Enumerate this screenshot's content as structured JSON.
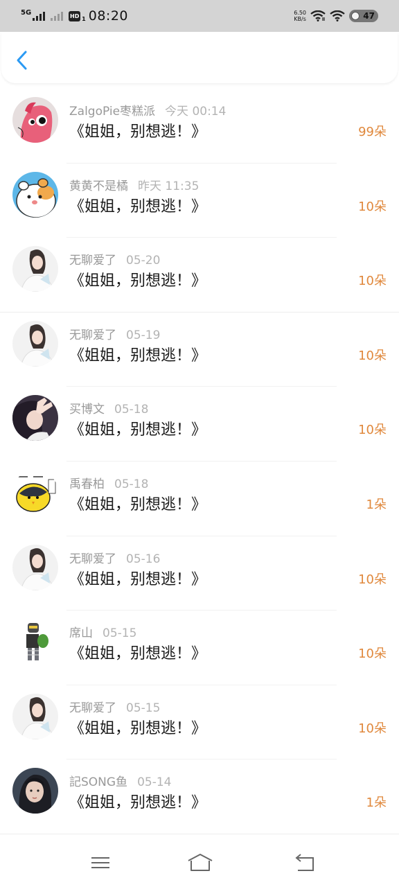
{
  "status_bar": {
    "network": "5G",
    "hd": "HD",
    "hd_sub": "1",
    "time": "08:20",
    "speed_value": "6.50",
    "speed_unit": "KB/s",
    "battery": "47"
  },
  "header": {
    "back_icon": "chevron-left-icon"
  },
  "gift_rows": [
    {
      "user": "ZalgoPie枣糕派",
      "time": "今天 00:14",
      "gift": "《姐姐，别想逃！》",
      "count": "99朵",
      "avatar": "pink-pony"
    },
    {
      "user": "黄黄不是橘",
      "time": "昨天 11:35",
      "gift": "《姐姐，别想逃！》",
      "count": "10朵",
      "avatar": "hamster"
    },
    {
      "user": "无聊爱了",
      "time": "05-20",
      "gift": "《姐姐，别想逃！》",
      "count": "10朵",
      "avatar": "girl-white"
    },
    {
      "user": "无聊爱了",
      "time": "05-19",
      "gift": "《姐姐，别想逃！》",
      "count": "10朵",
      "avatar": "girl-white"
    },
    {
      "user": "买博文",
      "time": "05-18",
      "gift": "《姐姐，别想逃！》",
      "count": "10朵",
      "avatar": "girl-hand"
    },
    {
      "user": "禹春柏",
      "time": "05-18",
      "gift": "《姐姐，别想逃！》",
      "count": "1朵",
      "avatar": "yellow-chick"
    },
    {
      "user": "无聊爱了",
      "time": "05-16",
      "gift": "《姐姐，别想逃！》",
      "count": "10朵",
      "avatar": "girl-white"
    },
    {
      "user": "席山",
      "time": "05-15",
      "gift": "《姐姐，别想逃！》",
      "count": "10朵",
      "avatar": "robot-figure"
    },
    {
      "user": "无聊爱了",
      "time": "05-15",
      "gift": "《姐姐，别想逃！》",
      "count": "10朵",
      "avatar": "girl-white"
    },
    {
      "user": "記SONG鱼",
      "time": "05-14",
      "gift": "《姐姐，别想逃！》",
      "count": "1朵",
      "avatar": "girl-dark"
    }
  ],
  "nav_bar": {
    "menu_icon": "menu-icon",
    "home_icon": "home-icon",
    "back_icon": "back-icon"
  },
  "colors": {
    "accent_blue": "#2b9af3",
    "count_orange": "#e0883c",
    "name_gray": "#999999"
  }
}
